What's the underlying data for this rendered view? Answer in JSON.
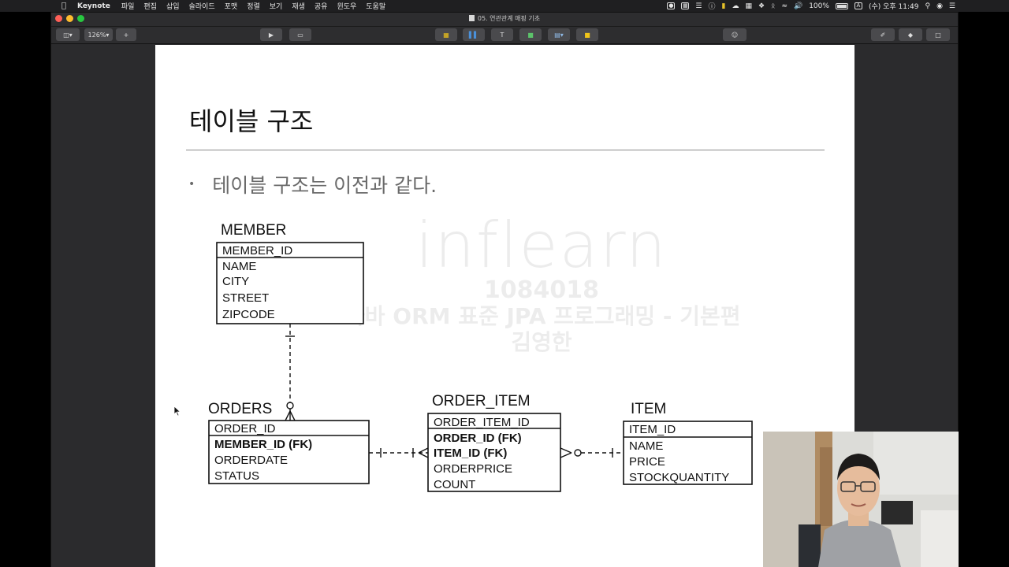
{
  "menubar": {
    "app": "Keynote",
    "menus": [
      "파일",
      "편집",
      "삽입",
      "슬라이드",
      "포맷",
      "정렬",
      "보기",
      "재생",
      "공유",
      "윈도우",
      "도움말"
    ],
    "battery": "100%",
    "clock": "(수) 오후 11:49"
  },
  "window": {
    "title": "05. 연관관계 매핑 기초",
    "zoom": "126%"
  },
  "slide": {
    "title": "테이블 구조",
    "bullet": "테이블 구조는 이전과 같다.",
    "watermark": {
      "logo": "inflearn",
      "id": "1084018",
      "course": "자바 ORM 표준 JPA 프로그래밍 - 기본편",
      "author": "김영한"
    }
  },
  "erd": {
    "member": {
      "name": "MEMBER",
      "pk": "MEMBER_ID",
      "fields": [
        "NAME",
        "CITY",
        "STREET",
        "ZIPCODE"
      ]
    },
    "orders": {
      "name": "ORDERS",
      "pk": "ORDER_ID",
      "fk": [
        "MEMBER_ID (FK)"
      ],
      "fields": [
        "ORDERDATE",
        "STATUS"
      ]
    },
    "order_item": {
      "name": "ORDER_ITEM",
      "pk": "ORDER_ITEM_ID",
      "fk": [
        "ORDER_ID (FK)",
        "ITEM_ID (FK)"
      ],
      "fields": [
        "ORDERPRICE",
        "COUNT"
      ]
    },
    "item": {
      "name": "ITEM",
      "pk": "ITEM_ID",
      "fields": [
        "NAME",
        "PRICE",
        "STOCKQUANTITY"
      ]
    }
  },
  "colors": {
    "menubar_bg": "#1f1f21",
    "toolbar_bg": "#2d2d2f",
    "slide_bg": "#ffffff",
    "close": "#ff5f57",
    "minimize": "#febc2e",
    "zoom": "#28c840"
  }
}
